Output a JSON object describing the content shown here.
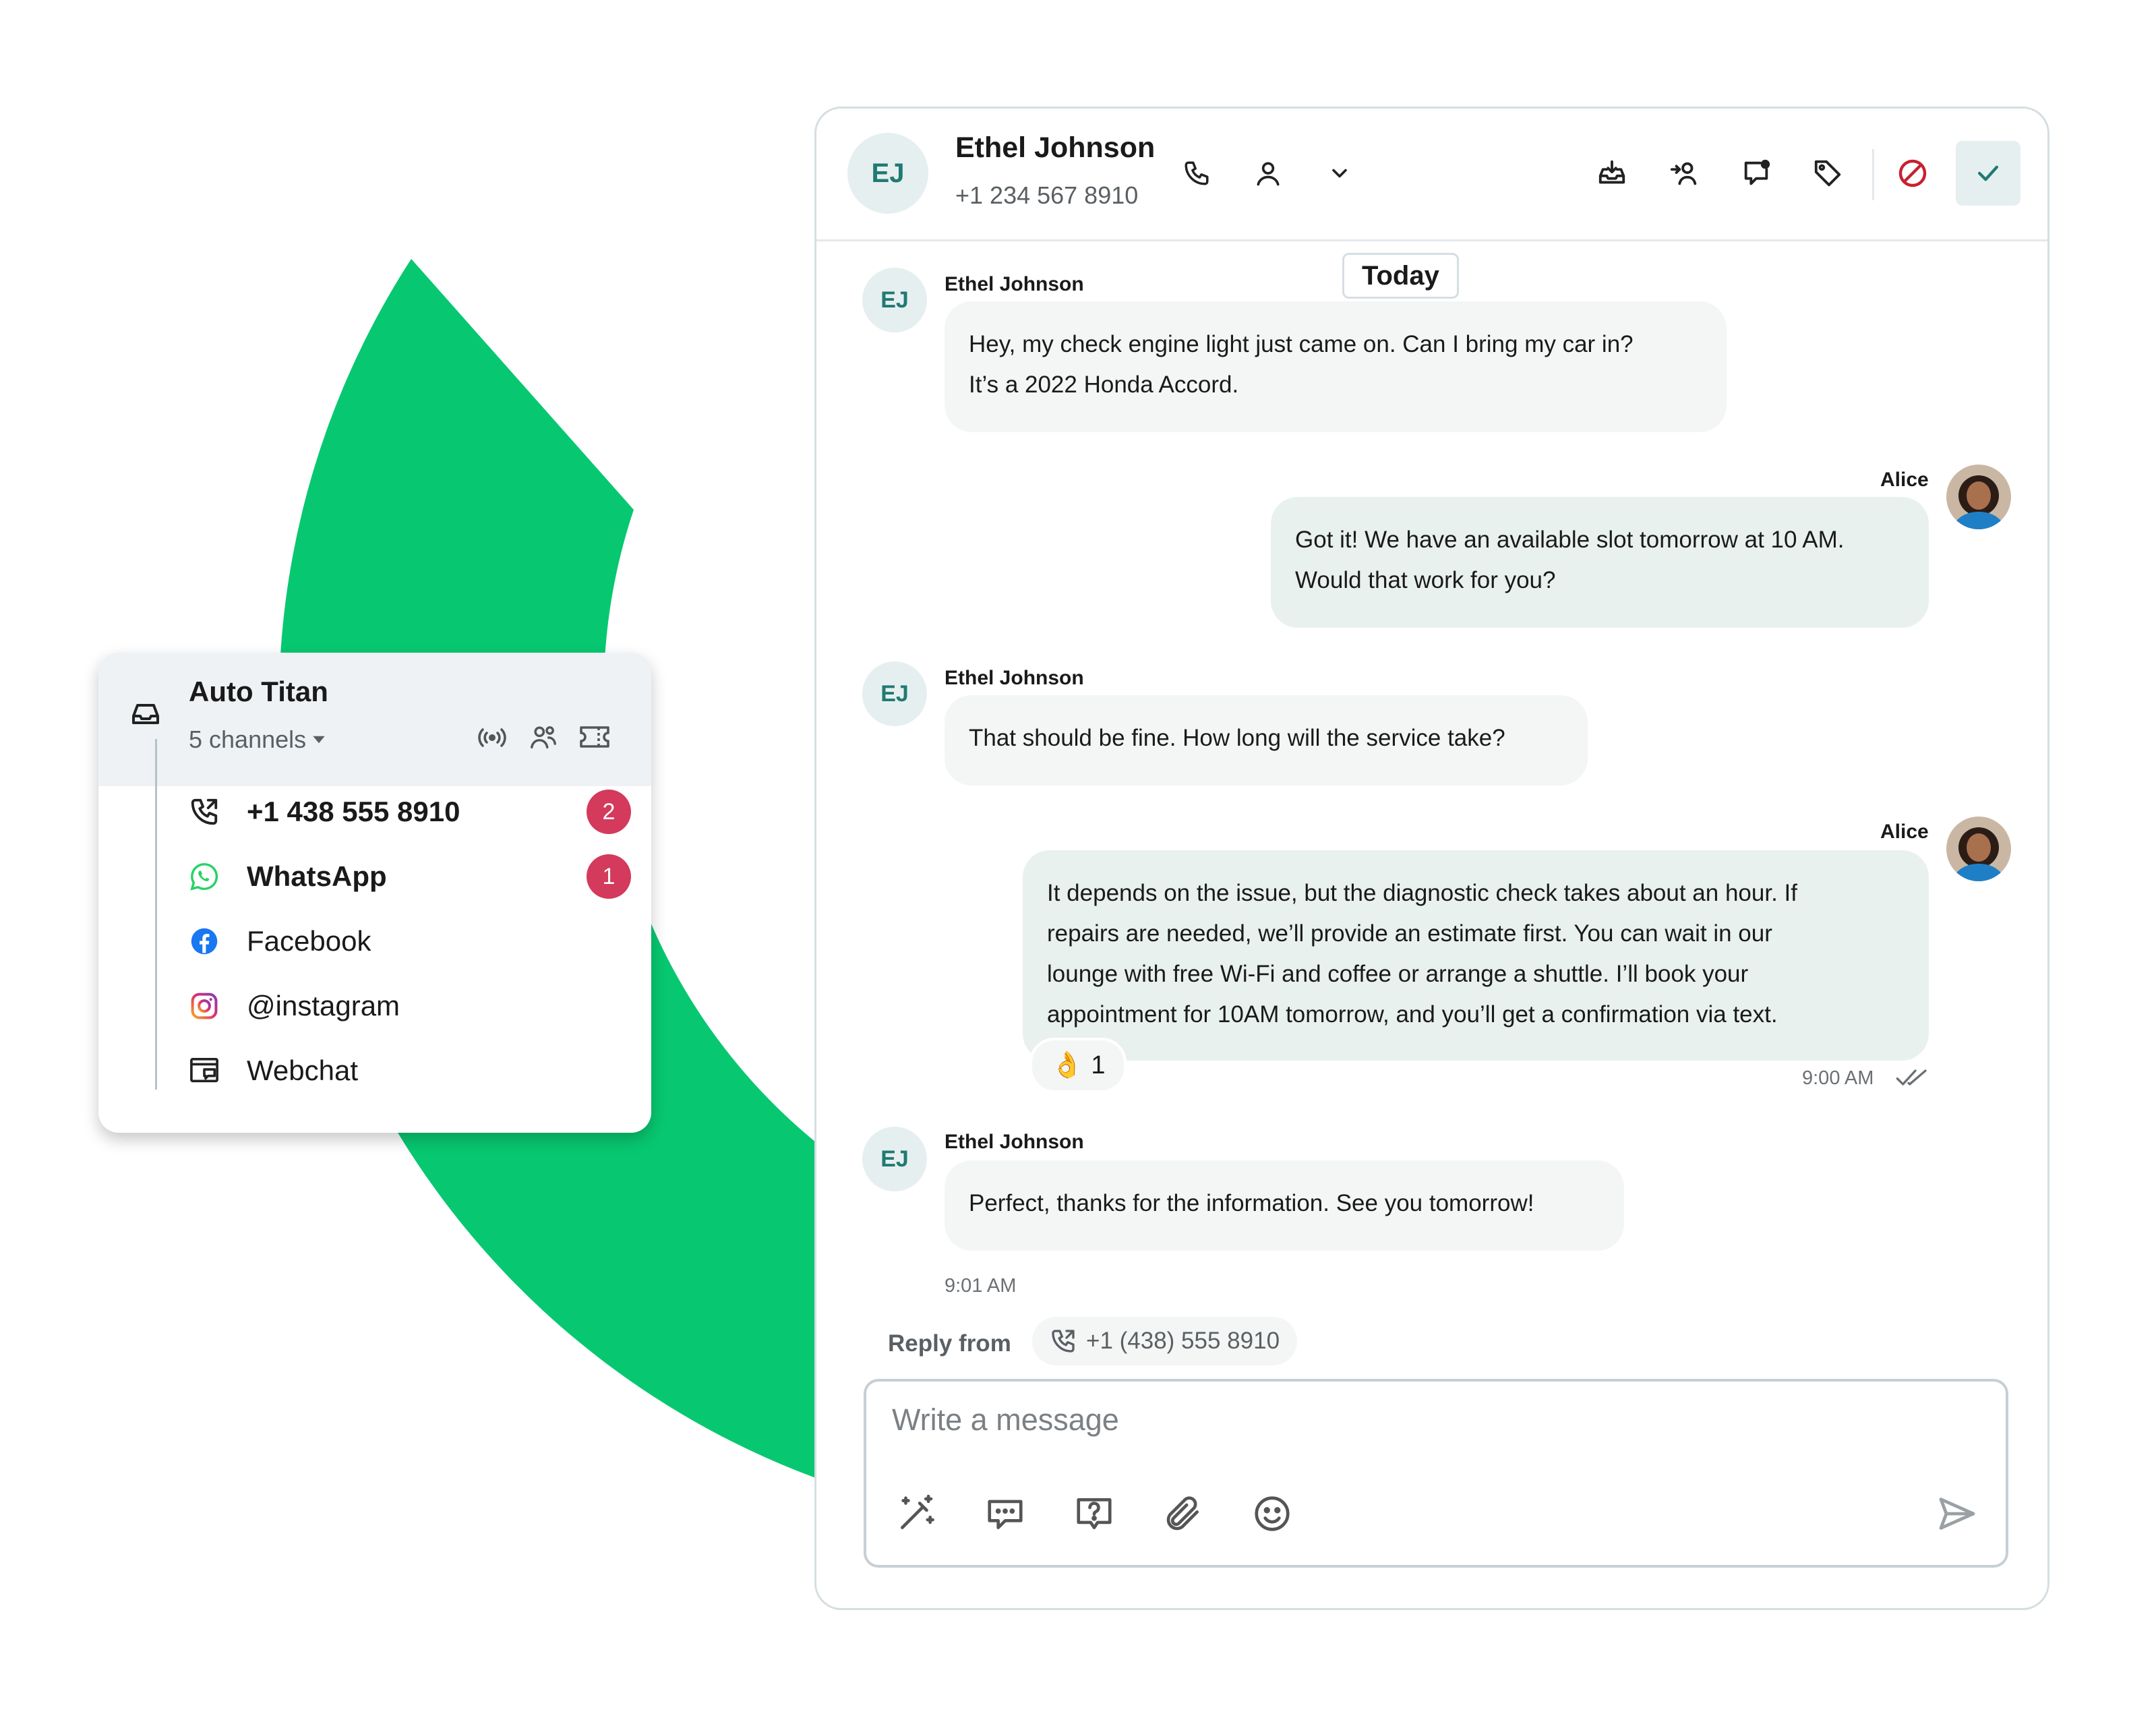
{
  "header": {
    "initials": "EJ",
    "name": "Ethel Johnson",
    "phone": "+1 234 567 8910"
  },
  "timeline": {
    "today_label": "Today"
  },
  "messages": [
    {
      "sender": "Ethel Johnson",
      "initials": "EJ",
      "direction": "in",
      "lines": [
        "Hey, my check engine light just came on. Can I bring my car in?",
        "It’s a 2022 Honda Accord."
      ]
    },
    {
      "sender": "Alice",
      "direction": "out",
      "lines": [
        "Got it! We have an available slot tomorrow at 10 AM.",
        "Would that work for you?"
      ]
    },
    {
      "sender": "Ethel Johnson",
      "initials": "EJ",
      "direction": "in",
      "lines": [
        "That should be fine. How long will the service take?"
      ]
    },
    {
      "sender": "Alice",
      "direction": "out",
      "lines": [
        "It depends on the issue, but the diagnostic check takes about an hour. If",
        "repairs are needed, we’ll provide an estimate first. You can wait in our",
        "lounge with free Wi-Fi and coffee or arrange a shuttle. I’ll book your",
        "appointment for 10AM tomorrow, and you’ll get a confirmation via text."
      ],
      "reaction": {
        "emoji": "👌",
        "count": "1"
      },
      "time": "9:00 AM"
    },
    {
      "sender": "Ethel Johnson",
      "initials": "EJ",
      "direction": "in",
      "lines": [
        "Perfect, thanks for the information. See you tomorrow!"
      ],
      "time": "9:01 AM"
    }
  ],
  "reply": {
    "label": "Reply from",
    "number": "+1 (438) 555 8910"
  },
  "composer": {
    "placeholder": "Write a message"
  },
  "inbox": {
    "title": "Auto Titan",
    "subtitle": "5 channels",
    "channels": [
      {
        "label": "+1 438 555 8910",
        "icon": "phone-icon",
        "badge": "2"
      },
      {
        "label": "WhatsApp",
        "icon": "whatsapp-icon",
        "badge": "1"
      },
      {
        "label": "Facebook",
        "icon": "facebook-icon"
      },
      {
        "label": "@instagram",
        "icon": "instagram-icon"
      },
      {
        "label": "Webchat",
        "icon": "webchat-icon"
      }
    ]
  },
  "colors": {
    "brand_green": "#07c870",
    "badge": "#d33a5c",
    "avatar_bg": "#e6efef",
    "avatar_text": "#1f7a74",
    "block": "#c8202f"
  }
}
